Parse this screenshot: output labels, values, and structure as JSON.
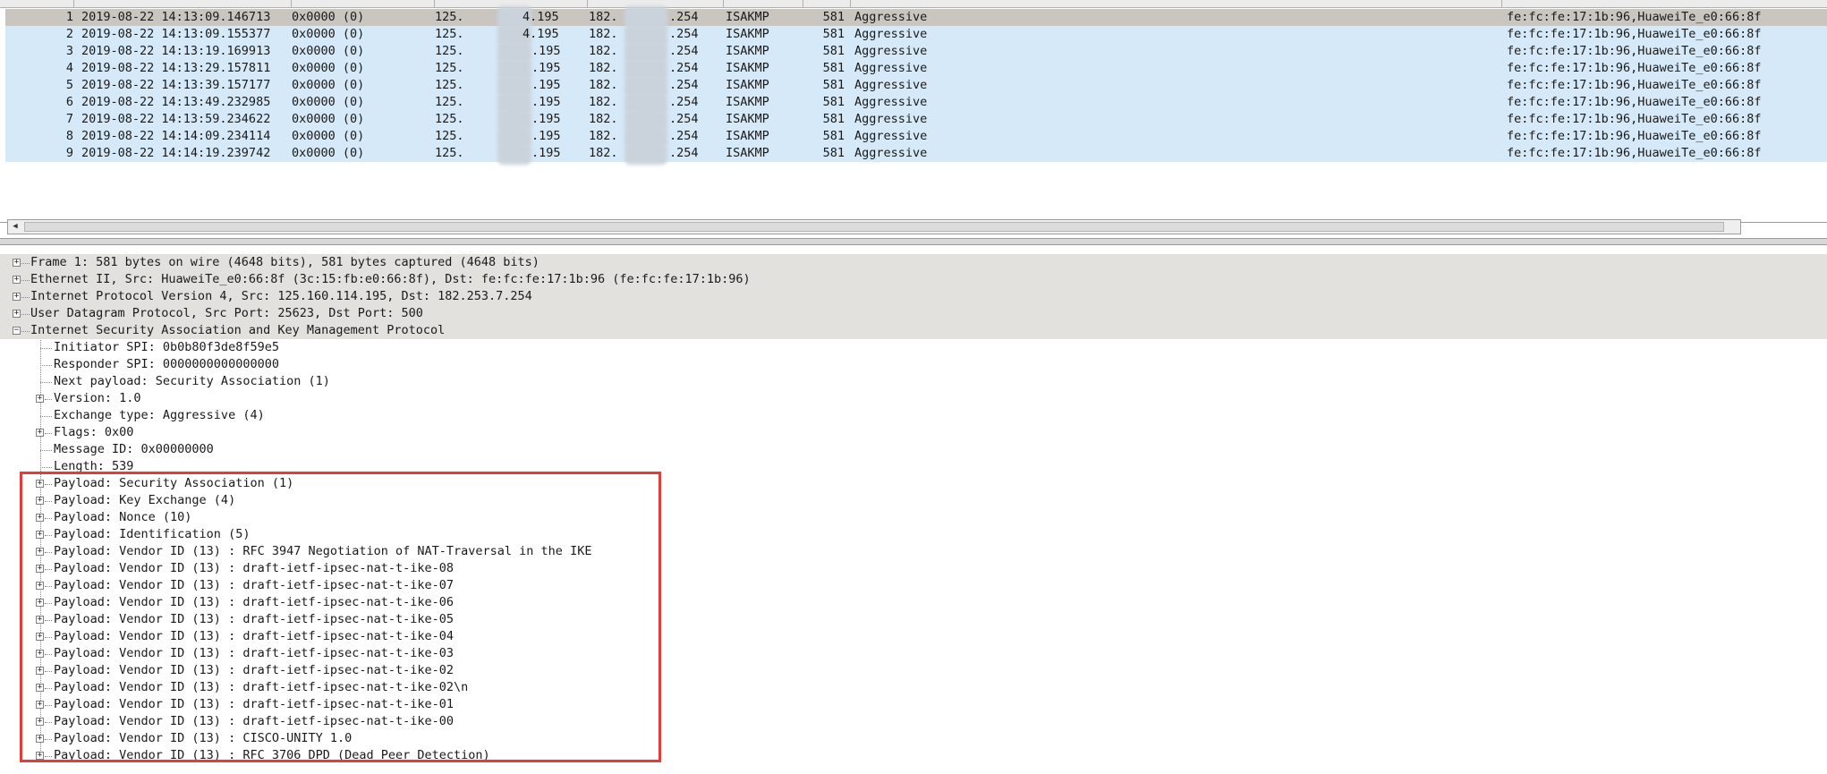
{
  "packets": [
    {
      "no": "1",
      "time": "2019-08-22 14:13:09.146713",
      "id": "0x0000 (0)",
      "src_prefix": "125.",
      "src_suffix": "4.195",
      "dst_prefix": "182.",
      "dst_suffix": ".254",
      "protocol": "ISAKMP",
      "length": "581",
      "info": "Aggressive",
      "extra": "fe:fc:fe:17:1b:96,HuaweiTe_e0:66:8f",
      "selected": true
    },
    {
      "no": "2",
      "time": "2019-08-22 14:13:09.155377",
      "id": "0x0000 (0)",
      "src_prefix": "125.",
      "src_suffix": "4.195",
      "dst_prefix": "182.",
      "dst_suffix": ".254",
      "protocol": "ISAKMP",
      "length": "581",
      "info": "Aggressive",
      "extra": "fe:fc:fe:17:1b:96,HuaweiTe_e0:66:8f"
    },
    {
      "no": "3",
      "time": "2019-08-22 14:13:19.169913",
      "id": "0x0000 (0)",
      "src_prefix": "125.",
      "src_suffix": ".195",
      "dst_prefix": "182.",
      "dst_suffix": ".254",
      "protocol": "ISAKMP",
      "length": "581",
      "info": "Aggressive",
      "extra": "fe:fc:fe:17:1b:96,HuaweiTe_e0:66:8f"
    },
    {
      "no": "4",
      "time": "2019-08-22 14:13:29.157811",
      "id": "0x0000 (0)",
      "src_prefix": "125.",
      "src_suffix": ".195",
      "dst_prefix": "182.",
      "dst_suffix": ".254",
      "protocol": "ISAKMP",
      "length": "581",
      "info": "Aggressive",
      "extra": "fe:fc:fe:17:1b:96,HuaweiTe_e0:66:8f"
    },
    {
      "no": "5",
      "time": "2019-08-22 14:13:39.157177",
      "id": "0x0000 (0)",
      "src_prefix": "125.",
      "src_suffix": ".195",
      "dst_prefix": "182.",
      "dst_suffix": ".254",
      "protocol": "ISAKMP",
      "length": "581",
      "info": "Aggressive",
      "extra": "fe:fc:fe:17:1b:96,HuaweiTe_e0:66:8f"
    },
    {
      "no": "6",
      "time": "2019-08-22 14:13:49.232985",
      "id": "0x0000 (0)",
      "src_prefix": "125.",
      "src_suffix": ".195",
      "dst_prefix": "182.",
      "dst_suffix": ".254",
      "protocol": "ISAKMP",
      "length": "581",
      "info": "Aggressive",
      "extra": "fe:fc:fe:17:1b:96,HuaweiTe_e0:66:8f"
    },
    {
      "no": "7",
      "time": "2019-08-22 14:13:59.234622",
      "id": "0x0000 (0)",
      "src_prefix": "125.",
      "src_suffix": ".195",
      "dst_prefix": "182.",
      "dst_suffix": ".254",
      "protocol": "ISAKMP",
      "length": "581",
      "info": "Aggressive",
      "extra": "fe:fc:fe:17:1b:96,HuaweiTe_e0:66:8f"
    },
    {
      "no": "8",
      "time": "2019-08-22 14:14:09.234114",
      "id": "0x0000 (0)",
      "src_prefix": "125.",
      "src_suffix": ".195",
      "dst_prefix": "182.",
      "dst_suffix": ".254",
      "protocol": "ISAKMP",
      "length": "581",
      "info": "Aggressive",
      "extra": "fe:fc:fe:17:1b:96,HuaweiTe_e0:66:8f"
    },
    {
      "no": "9",
      "time": "2019-08-22 14:14:19.239742",
      "id": "0x0000 (0)",
      "src_prefix": "125.",
      "src_suffix": ".195",
      "dst_prefix": "182.",
      "dst_suffix": ".254",
      "protocol": "ISAKMP",
      "length": "581",
      "info": "Aggressive",
      "extra": "fe:fc:fe:17:1b:96,HuaweiTe_e0:66:8f"
    }
  ],
  "details": {
    "top_items": [
      "Frame 1: 581 bytes on wire (4648 bits), 581 bytes captured (4648 bits)",
      "Ethernet II, Src: HuaweiTe_e0:66:8f (3c:15:fb:e0:66:8f), Dst: fe:fc:fe:17:1b:96 (fe:fc:fe:17:1b:96)",
      "Internet Protocol Version 4, Src: 125.160.114.195, Dst: 182.253.7.254",
      "User Datagram Protocol, Src Port: 25623, Dst Port: 500",
      "Internet Security Association and Key Management Protocol"
    ],
    "isakmp_fields": [
      {
        "label": "Initiator SPI: 0b0b80f3de8f59e5",
        "expandable": false
      },
      {
        "label": "Responder SPI: 0000000000000000",
        "expandable": false
      },
      {
        "label": "Next payload: Security Association (1)",
        "expandable": false
      },
      {
        "label": "Version: 1.0",
        "expandable": true
      },
      {
        "label": "Exchange type: Aggressive (4)",
        "expandable": false
      },
      {
        "label": "Flags: 0x00",
        "expandable": true
      },
      {
        "label": "Message ID: 0x00000000",
        "expandable": false
      },
      {
        "label": "Length: 539",
        "expandable": false
      }
    ],
    "payloads": [
      "Payload: Security Association (1)",
      "Payload: Key Exchange (4)",
      "Payload: Nonce (10)",
      "Payload: Identification (5)",
      "Payload: Vendor ID (13) : RFC 3947 Negotiation of NAT-Traversal in the IKE",
      "Payload: Vendor ID (13) : draft-ietf-ipsec-nat-t-ike-08",
      "Payload: Vendor ID (13) : draft-ietf-ipsec-nat-t-ike-07",
      "Payload: Vendor ID (13) : draft-ietf-ipsec-nat-t-ike-06",
      "Payload: Vendor ID (13) : draft-ietf-ipsec-nat-t-ike-05",
      "Payload: Vendor ID (13) : draft-ietf-ipsec-nat-t-ike-04",
      "Payload: Vendor ID (13) : draft-ietf-ipsec-nat-t-ike-03",
      "Payload: Vendor ID (13) : draft-ietf-ipsec-nat-t-ike-02",
      "Payload: Vendor ID (13) : draft-ietf-ipsec-nat-t-ike-02\\n",
      "Payload: Vendor ID (13) : draft-ietf-ipsec-nat-t-ike-01",
      "Payload: Vendor ID (13) : draft-ietf-ipsec-nat-t-ike-00",
      "Payload: Vendor ID (13) : CISCO-UNITY 1.0",
      "Payload: Vendor ID (13) : RFC 3706 DPD (Dead Peer Detection)"
    ]
  },
  "icons": {
    "expand": "plus-box-icon",
    "collapse": "minus-box-icon",
    "scroll_left": "scroll-left-arrow-icon"
  },
  "colors": {
    "row_bg": "#d6e9f8",
    "selected_row_bg": "#c9c5bf",
    "highlight_border": "#e43b3b"
  }
}
